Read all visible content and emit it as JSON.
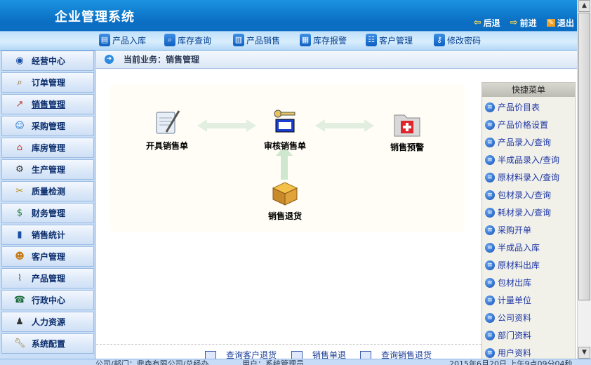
{
  "header": {
    "title": "企业管理系统",
    "back_label": "后退",
    "forward_label": "前进",
    "exit_label": "退出"
  },
  "toolbar": [
    {
      "label": "产品入库",
      "icon": "document-icon"
    },
    {
      "label": "库存查询",
      "icon": "search-icon"
    },
    {
      "label": "产品销售",
      "icon": "sales-icon"
    },
    {
      "label": "库存报警",
      "icon": "alarm-icon"
    },
    {
      "label": "客户管理",
      "icon": "users-icon"
    },
    {
      "label": "修改密码",
      "icon": "key-icon"
    }
  ],
  "sidebar": {
    "items": [
      {
        "label": "经营中心",
        "icon": "globe-icon"
      },
      {
        "label": "订单管理",
        "icon": "magnifier-icon"
      },
      {
        "label": "销售管理",
        "icon": "chart-icon"
      },
      {
        "label": "采购管理",
        "icon": "people-icon"
      },
      {
        "label": "库房管理",
        "icon": "house-icon"
      },
      {
        "label": "生产管理",
        "icon": "worker-icon"
      },
      {
        "label": "质量检测",
        "icon": "tools-icon"
      },
      {
        "label": "财务管理",
        "icon": "money-icon"
      },
      {
        "label": "销售统计",
        "icon": "bar-chart-icon"
      },
      {
        "label": "客户管理",
        "icon": "customers-icon"
      },
      {
        "label": "产品管理",
        "icon": "line-chart-icon"
      },
      {
        "label": "行政中心",
        "icon": "phone-icon"
      },
      {
        "label": "人力资源",
        "icon": "group-icon"
      },
      {
        "label": "系统配置",
        "icon": "wrench-icon"
      }
    ],
    "active": "销售管理"
  },
  "breadcrumb": {
    "text": "当前业务：销售管理"
  },
  "flow": {
    "nodes": [
      {
        "label": "开具销售单",
        "icon": "invoice-pen-icon"
      },
      {
        "label": "审核销售单",
        "icon": "audit-key-icon"
      },
      {
        "label": "销售预警",
        "icon": "warning-folder-icon"
      },
      {
        "label": "销售退货",
        "icon": "return-box-icon"
      }
    ]
  },
  "quick_menu": {
    "title": "快捷菜单",
    "items": [
      "产品价目表",
      "产品价格设置",
      "产品录入/查询",
      "半成品录入/查询",
      "原材料录入/查询",
      "包材录入/查询",
      "耗材录入/查询",
      "采购开单",
      "半成品入库",
      "原材料出库",
      "包材出库",
      "计量单位",
      "公司资料",
      "部门资料",
      "用户资料"
    ]
  },
  "bottom_links": [
    "查询客户退货",
    "销售单退",
    "查询销售退货"
  ],
  "statusbar": {
    "company": "公司/部门：鼎森有限公司/总经办",
    "user": "用户：系统管理员",
    "datetime": "2015年6月20日 上午9点09分04秒"
  },
  "colors": {
    "header": "#0b6fc4",
    "sidebar": "#c9def7",
    "link": "#1e36a3"
  }
}
